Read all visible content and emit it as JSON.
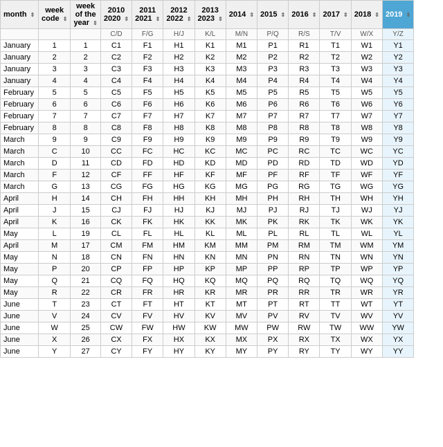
{
  "columns": [
    {
      "key": "month",
      "label": "month",
      "sub": ""
    },
    {
      "key": "week_code",
      "label": "week code",
      "sub": ""
    },
    {
      "key": "week_of_year",
      "label": "week of the year",
      "sub": ""
    },
    {
      "key": "y2010",
      "label": "2010 2020",
      "sub": "C/D"
    },
    {
      "key": "y2011",
      "label": "2011 2021",
      "sub": "F/G"
    },
    {
      "key": "y2012",
      "label": "2012 2022",
      "sub": "H/J"
    },
    {
      "key": "y2013",
      "label": "2013 2023",
      "sub": "K/L"
    },
    {
      "key": "y2014",
      "label": "2014",
      "sub": "M/N"
    },
    {
      "key": "y2015",
      "label": "2015",
      "sub": "P/Q"
    },
    {
      "key": "y2016",
      "label": "2016",
      "sub": "R/S"
    },
    {
      "key": "y2017",
      "label": "2017",
      "sub": "T/V"
    },
    {
      "key": "y2018",
      "label": "2018",
      "sub": "W/X"
    },
    {
      "key": "y2019",
      "label": "2019",
      "sub": "Y/Z",
      "highlight": true
    }
  ],
  "rows": [
    [
      "January",
      "1",
      "1",
      "C1",
      "F1",
      "H1",
      "K1",
      "M1",
      "P1",
      "R1",
      "T1",
      "W1",
      "Y1"
    ],
    [
      "January",
      "2",
      "2",
      "C2",
      "F2",
      "H2",
      "K2",
      "M2",
      "P2",
      "R2",
      "T2",
      "W2",
      "Y2"
    ],
    [
      "January",
      "3",
      "3",
      "C3",
      "F3",
      "H3",
      "K3",
      "M3",
      "P3",
      "R3",
      "T3",
      "W3",
      "Y3"
    ],
    [
      "January",
      "4",
      "4",
      "C4",
      "F4",
      "H4",
      "K4",
      "M4",
      "P4",
      "R4",
      "T4",
      "W4",
      "Y4"
    ],
    [
      "February",
      "5",
      "5",
      "C5",
      "F5",
      "H5",
      "K5",
      "M5",
      "P5",
      "R5",
      "T5",
      "W5",
      "Y5"
    ],
    [
      "February",
      "6",
      "6",
      "C6",
      "F6",
      "H6",
      "K6",
      "M6",
      "P6",
      "R6",
      "T6",
      "W6",
      "Y6"
    ],
    [
      "February",
      "7",
      "7",
      "C7",
      "F7",
      "H7",
      "K7",
      "M7",
      "P7",
      "R7",
      "T7",
      "W7",
      "Y7"
    ],
    [
      "February",
      "8",
      "8",
      "C8",
      "F8",
      "H8",
      "K8",
      "M8",
      "P8",
      "R8",
      "T8",
      "W8",
      "Y8"
    ],
    [
      "March",
      "9",
      "9",
      "C9",
      "F9",
      "H9",
      "K9",
      "M9",
      "P9",
      "R9",
      "T9",
      "W9",
      "Y9"
    ],
    [
      "March",
      "C",
      "10",
      "CC",
      "FC",
      "HC",
      "KC",
      "MC",
      "PC",
      "RC",
      "TC",
      "WC",
      "YC"
    ],
    [
      "March",
      "D",
      "11",
      "CD",
      "FD",
      "HD",
      "KD",
      "MD",
      "PD",
      "RD",
      "TD",
      "WD",
      "YD"
    ],
    [
      "March",
      "F",
      "12",
      "CF",
      "FF",
      "HF",
      "KF",
      "MF",
      "PF",
      "RF",
      "TF",
      "WF",
      "YF"
    ],
    [
      "March",
      "G",
      "13",
      "CG",
      "FG",
      "HG",
      "KG",
      "MG",
      "PG",
      "RG",
      "TG",
      "WG",
      "YG"
    ],
    [
      "April",
      "H",
      "14",
      "CH",
      "FH",
      "HH",
      "KH",
      "MH",
      "PH",
      "RH",
      "TH",
      "WH",
      "YH"
    ],
    [
      "April",
      "J",
      "15",
      "CJ",
      "FJ",
      "HJ",
      "KJ",
      "MJ",
      "PJ",
      "RJ",
      "TJ",
      "WJ",
      "YJ"
    ],
    [
      "April",
      "K",
      "16",
      "CK",
      "FK",
      "HK",
      "KK",
      "MK",
      "PK",
      "RK",
      "TK",
      "WK",
      "YK"
    ],
    [
      "May",
      "L",
      "19",
      "CL",
      "FL",
      "HL",
      "KL",
      "ML",
      "PL",
      "RL",
      "TL",
      "WL",
      "YL"
    ],
    [
      "April",
      "M",
      "17",
      "CM",
      "FM",
      "HM",
      "KM",
      "MM",
      "PM",
      "RM",
      "TM",
      "WM",
      "YM"
    ],
    [
      "May",
      "N",
      "18",
      "CN",
      "FN",
      "HN",
      "KN",
      "MN",
      "PN",
      "RN",
      "TN",
      "WN",
      "YN"
    ],
    [
      "May",
      "P",
      "20",
      "CP",
      "FP",
      "HP",
      "KP",
      "MP",
      "PP",
      "RP",
      "TP",
      "WP",
      "YP"
    ],
    [
      "May",
      "Q",
      "21",
      "CQ",
      "FQ",
      "HQ",
      "KQ",
      "MQ",
      "PQ",
      "RQ",
      "TQ",
      "WQ",
      "YQ"
    ],
    [
      "May",
      "R",
      "22",
      "CR",
      "FR",
      "HR",
      "KR",
      "MR",
      "PR",
      "RR",
      "TR",
      "WR",
      "YR"
    ],
    [
      "June",
      "T",
      "23",
      "CT",
      "FT",
      "HT",
      "KT",
      "MT",
      "PT",
      "RT",
      "TT",
      "WT",
      "YT"
    ],
    [
      "June",
      "V",
      "24",
      "CV",
      "FV",
      "HV",
      "KV",
      "MV",
      "PV",
      "RV",
      "TV",
      "WV",
      "YV"
    ],
    [
      "June",
      "W",
      "25",
      "CW",
      "FW",
      "HW",
      "KW",
      "MW",
      "PW",
      "RW",
      "TW",
      "WW",
      "YW"
    ],
    [
      "June",
      "X",
      "26",
      "CX",
      "FX",
      "HX",
      "KX",
      "MX",
      "PX",
      "RX",
      "TX",
      "WX",
      "YX"
    ],
    [
      "June",
      "Y",
      "27",
      "CY",
      "FY",
      "HY",
      "KY",
      "MY",
      "PY",
      "RY",
      "TY",
      "WY",
      "YY"
    ]
  ]
}
